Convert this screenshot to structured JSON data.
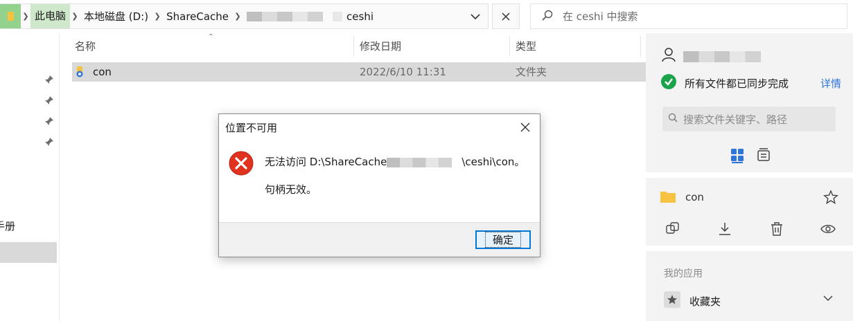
{
  "address_bar": {
    "breadcrumbs": [
      "此电脑",
      "本地磁盘 (D:)",
      "ShareCache",
      "ceshi"
    ],
    "search_placeholder": "在 ceshi 中搜索"
  },
  "left_nav": {
    "partial_label": "手册"
  },
  "file_list": {
    "columns": [
      "名称",
      "修改日期",
      "类型"
    ],
    "rows": [
      {
        "name": "con",
        "modified": "2022/6/10 11:31",
        "type": "文件夹"
      }
    ]
  },
  "right_panel": {
    "sync_status": "所有文件都已同步完成",
    "details_link": "详情",
    "search_placeholder": "搜索文件关键字、路径",
    "selected_item": "con",
    "my_apps_label": "我的应用",
    "favorites_label": "收藏夹"
  },
  "dialog": {
    "title": "位置不可用",
    "message_prefix": "无法访问 D:\\ShareCache",
    "message_suffix": "\\ceshi\\con。",
    "message_detail": "句柄无效。",
    "ok_label": "确定"
  },
  "colors": {
    "accent": "#2f74d9",
    "success": "#1aa34a",
    "error": "#e0321f",
    "folder": "#f5c341"
  }
}
